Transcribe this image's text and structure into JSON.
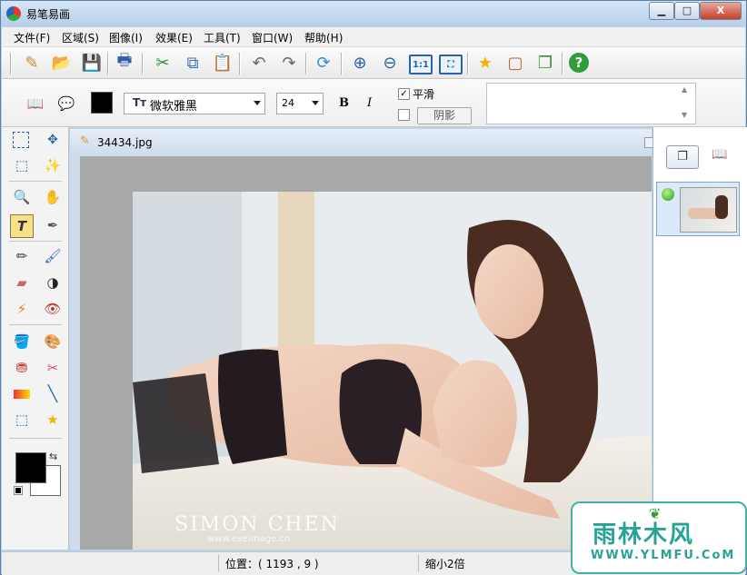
{
  "window": {
    "title": "易笔易画",
    "min_label": "▁",
    "max_label": "□",
    "close_label": "X"
  },
  "menu": [
    "文件(F)",
    "区域(S)",
    "图像(I)",
    "效果(E)",
    "工具(T)",
    "窗口(W)",
    "帮助(H)"
  ],
  "toolbar": {
    "zoom_actual_label": "1:1"
  },
  "text_options": {
    "font": "微软雅黑",
    "size": "24",
    "bold_label": "B",
    "italic_label": "I",
    "smooth_label": "平滑",
    "smooth_checked": true,
    "shadow_checked": false,
    "shadow_label": "阴影",
    "text_value": ""
  },
  "colors": {
    "foreground": "#000000",
    "background": "#ffffff",
    "accent": "#2c63a8"
  },
  "document": {
    "filename": "34434.jpg",
    "photo_watermark": "SIMON CHEN",
    "photo_watermark_url": "www.eveimage.cn"
  },
  "status": {
    "position": "位置：( 1193 , 9 )",
    "zoom": "缩小2倍"
  },
  "site_watermark": {
    "name": "雨林木风",
    "url": "WWW.YLMFU.CoM"
  }
}
